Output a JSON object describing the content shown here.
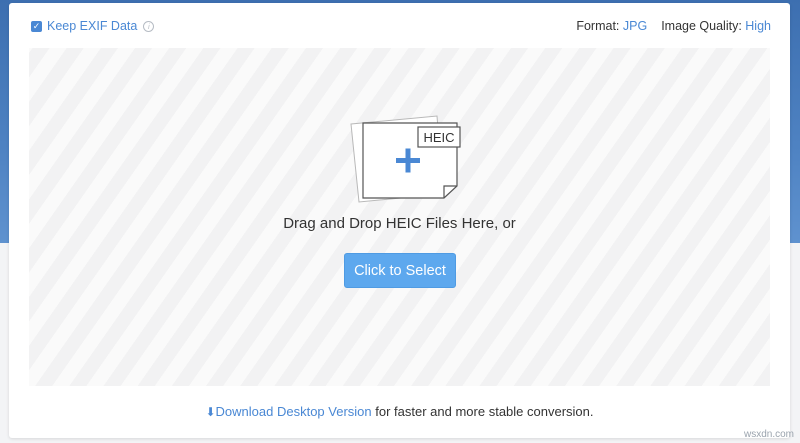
{
  "header": {
    "exif_label": "Keep EXIF Data",
    "exif_checked": true,
    "format_label": "Format:",
    "format_value": "JPG",
    "quality_label": "Image Quality:",
    "quality_value": "High"
  },
  "dropzone": {
    "badge": "HEIC",
    "instruction": "Drag and Drop HEIC Files Here, or",
    "button_label": "Click to Select"
  },
  "footer": {
    "link_text": "Download Desktop Version",
    "rest_text": "for faster and more stable conversion."
  },
  "watermark": "wsxdn.com",
  "colors": {
    "accent": "#4a88d4",
    "button": "#5da8ee",
    "banner": "#4e82c2"
  }
}
